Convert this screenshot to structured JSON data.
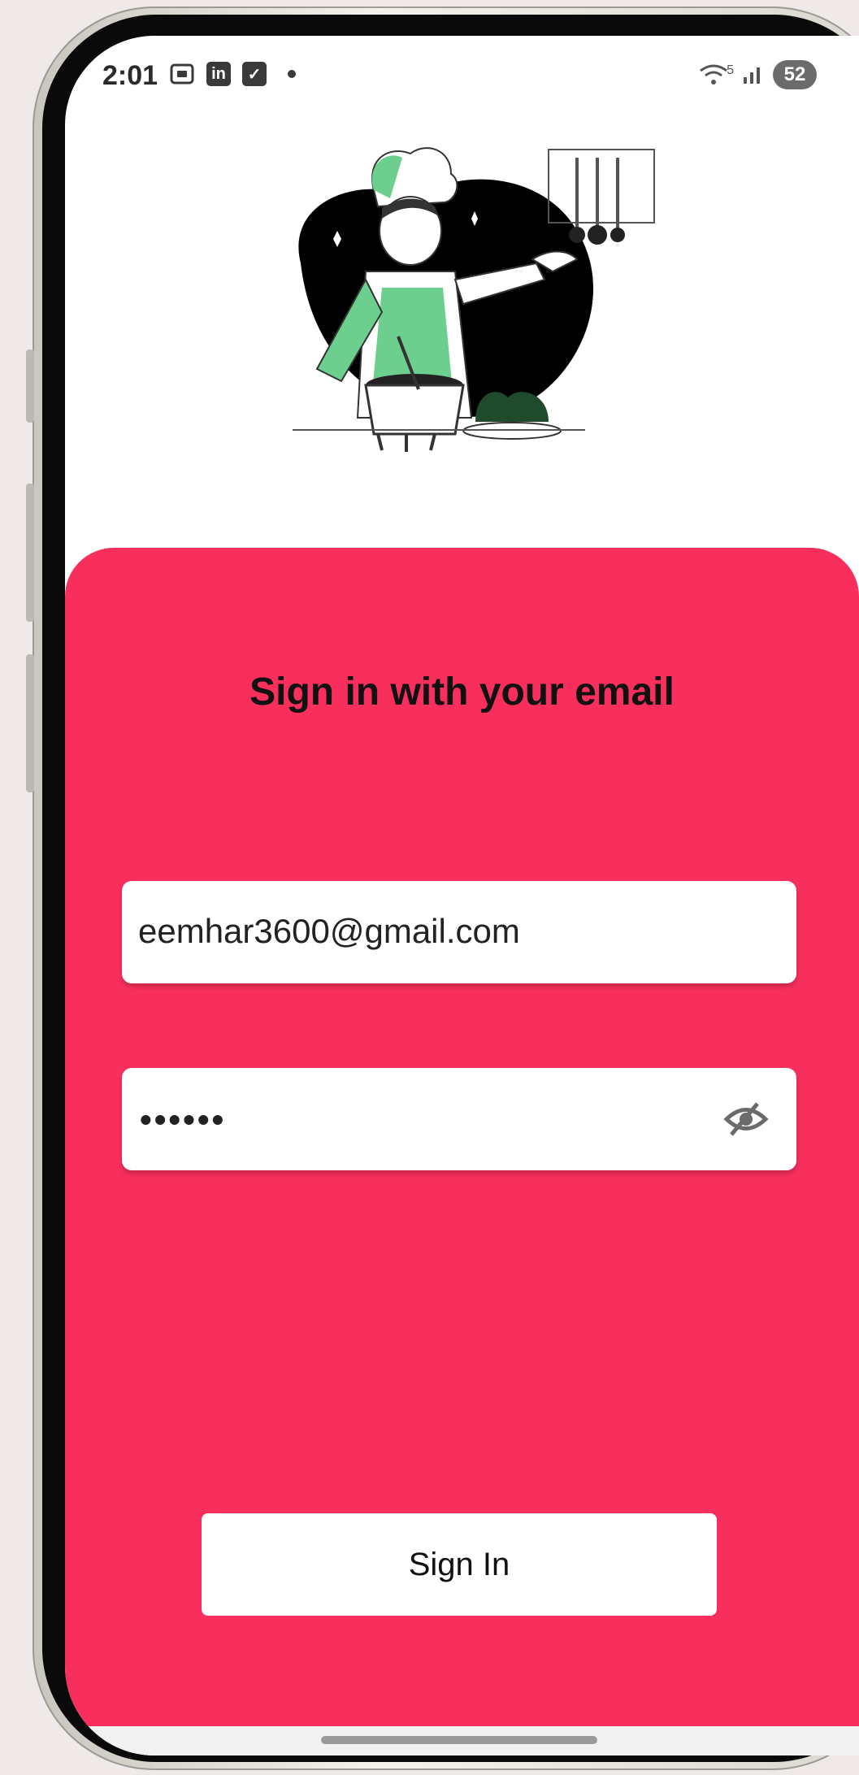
{
  "status_bar": {
    "time": "2:01",
    "linkedin_icon_text": "in",
    "network_text": "5",
    "battery": "52"
  },
  "icons": {
    "screenshot": "screenshot-icon",
    "linkedin": "linkedin-icon",
    "checkbox": "checkbox-icon",
    "wifi": "wifi-icon",
    "signal": "signal-icon",
    "battery": "battery-icon",
    "eye": "eye-off-icon"
  },
  "colors": {
    "accent": "#f82f5c",
    "illustration_green": "#6dcf8d"
  },
  "signin_card": {
    "title": "Sign in with your email",
    "email_value": "eemhar3600@gmail.com",
    "password_mask": "••••••",
    "signin_label": "Sign In"
  }
}
